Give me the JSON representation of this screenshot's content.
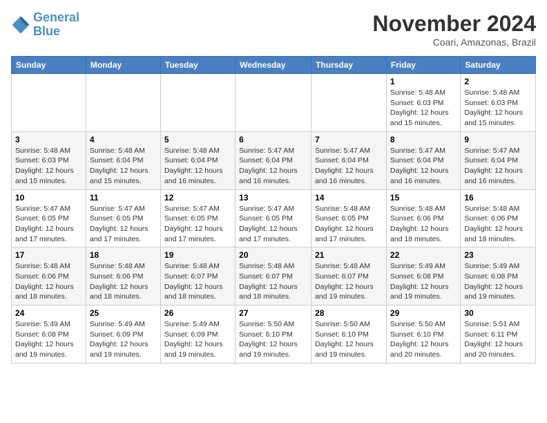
{
  "logo": {
    "line1": "General",
    "line2": "Blue"
  },
  "title": "November 2024",
  "location": "Coari, Amazonas, Brazil",
  "days_of_week": [
    "Sunday",
    "Monday",
    "Tuesday",
    "Wednesday",
    "Thursday",
    "Friday",
    "Saturday"
  ],
  "weeks": [
    [
      {
        "day": "",
        "info": ""
      },
      {
        "day": "",
        "info": ""
      },
      {
        "day": "",
        "info": ""
      },
      {
        "day": "",
        "info": ""
      },
      {
        "day": "",
        "info": ""
      },
      {
        "day": "1",
        "info": "Sunrise: 5:48 AM\nSunset: 6:03 PM\nDaylight: 12 hours and 15 minutes."
      },
      {
        "day": "2",
        "info": "Sunrise: 5:48 AM\nSunset: 6:03 PM\nDaylight: 12 hours and 15 minutes."
      }
    ],
    [
      {
        "day": "3",
        "info": "Sunrise: 5:48 AM\nSunset: 6:03 PM\nDaylight: 12 hours and 15 minutes."
      },
      {
        "day": "4",
        "info": "Sunrise: 5:48 AM\nSunset: 6:04 PM\nDaylight: 12 hours and 15 minutes."
      },
      {
        "day": "5",
        "info": "Sunrise: 5:48 AM\nSunset: 6:04 PM\nDaylight: 12 hours and 16 minutes."
      },
      {
        "day": "6",
        "info": "Sunrise: 5:47 AM\nSunset: 6:04 PM\nDaylight: 12 hours and 16 minutes."
      },
      {
        "day": "7",
        "info": "Sunrise: 5:47 AM\nSunset: 6:04 PM\nDaylight: 12 hours and 16 minutes."
      },
      {
        "day": "8",
        "info": "Sunrise: 5:47 AM\nSunset: 6:04 PM\nDaylight: 12 hours and 16 minutes."
      },
      {
        "day": "9",
        "info": "Sunrise: 5:47 AM\nSunset: 6:04 PM\nDaylight: 12 hours and 16 minutes."
      }
    ],
    [
      {
        "day": "10",
        "info": "Sunrise: 5:47 AM\nSunset: 6:05 PM\nDaylight: 12 hours and 17 minutes."
      },
      {
        "day": "11",
        "info": "Sunrise: 5:47 AM\nSunset: 6:05 PM\nDaylight: 12 hours and 17 minutes."
      },
      {
        "day": "12",
        "info": "Sunrise: 5:47 AM\nSunset: 6:05 PM\nDaylight: 12 hours and 17 minutes."
      },
      {
        "day": "13",
        "info": "Sunrise: 5:47 AM\nSunset: 6:05 PM\nDaylight: 12 hours and 17 minutes."
      },
      {
        "day": "14",
        "info": "Sunrise: 5:48 AM\nSunset: 6:05 PM\nDaylight: 12 hours and 17 minutes."
      },
      {
        "day": "15",
        "info": "Sunrise: 5:48 AM\nSunset: 6:06 PM\nDaylight: 12 hours and 18 minutes."
      },
      {
        "day": "16",
        "info": "Sunrise: 5:48 AM\nSunset: 6:06 PM\nDaylight: 12 hours and 18 minutes."
      }
    ],
    [
      {
        "day": "17",
        "info": "Sunrise: 5:48 AM\nSunset: 6:06 PM\nDaylight: 12 hours and 18 minutes."
      },
      {
        "day": "18",
        "info": "Sunrise: 5:48 AM\nSunset: 6:06 PM\nDaylight: 12 hours and 18 minutes."
      },
      {
        "day": "19",
        "info": "Sunrise: 5:48 AM\nSunset: 6:07 PM\nDaylight: 12 hours and 18 minutes."
      },
      {
        "day": "20",
        "info": "Sunrise: 5:48 AM\nSunset: 6:07 PM\nDaylight: 12 hours and 18 minutes."
      },
      {
        "day": "21",
        "info": "Sunrise: 5:48 AM\nSunset: 6:07 PM\nDaylight: 12 hours and 19 minutes."
      },
      {
        "day": "22",
        "info": "Sunrise: 5:49 AM\nSunset: 6:08 PM\nDaylight: 12 hours and 19 minutes."
      },
      {
        "day": "23",
        "info": "Sunrise: 5:49 AM\nSunset: 6:08 PM\nDaylight: 12 hours and 19 minutes."
      }
    ],
    [
      {
        "day": "24",
        "info": "Sunrise: 5:49 AM\nSunset: 6:08 PM\nDaylight: 12 hours and 19 minutes."
      },
      {
        "day": "25",
        "info": "Sunrise: 5:49 AM\nSunset: 6:09 PM\nDaylight: 12 hours and 19 minutes."
      },
      {
        "day": "26",
        "info": "Sunrise: 5:49 AM\nSunset: 6:09 PM\nDaylight: 12 hours and 19 minutes."
      },
      {
        "day": "27",
        "info": "Sunrise: 5:50 AM\nSunset: 6:10 PM\nDaylight: 12 hours and 19 minutes."
      },
      {
        "day": "28",
        "info": "Sunrise: 5:50 AM\nSunset: 6:10 PM\nDaylight: 12 hours and 19 minutes."
      },
      {
        "day": "29",
        "info": "Sunrise: 5:50 AM\nSunset: 6:10 PM\nDaylight: 12 hours and 20 minutes."
      },
      {
        "day": "30",
        "info": "Sunrise: 5:51 AM\nSunset: 6:11 PM\nDaylight: 12 hours and 20 minutes."
      }
    ]
  ]
}
